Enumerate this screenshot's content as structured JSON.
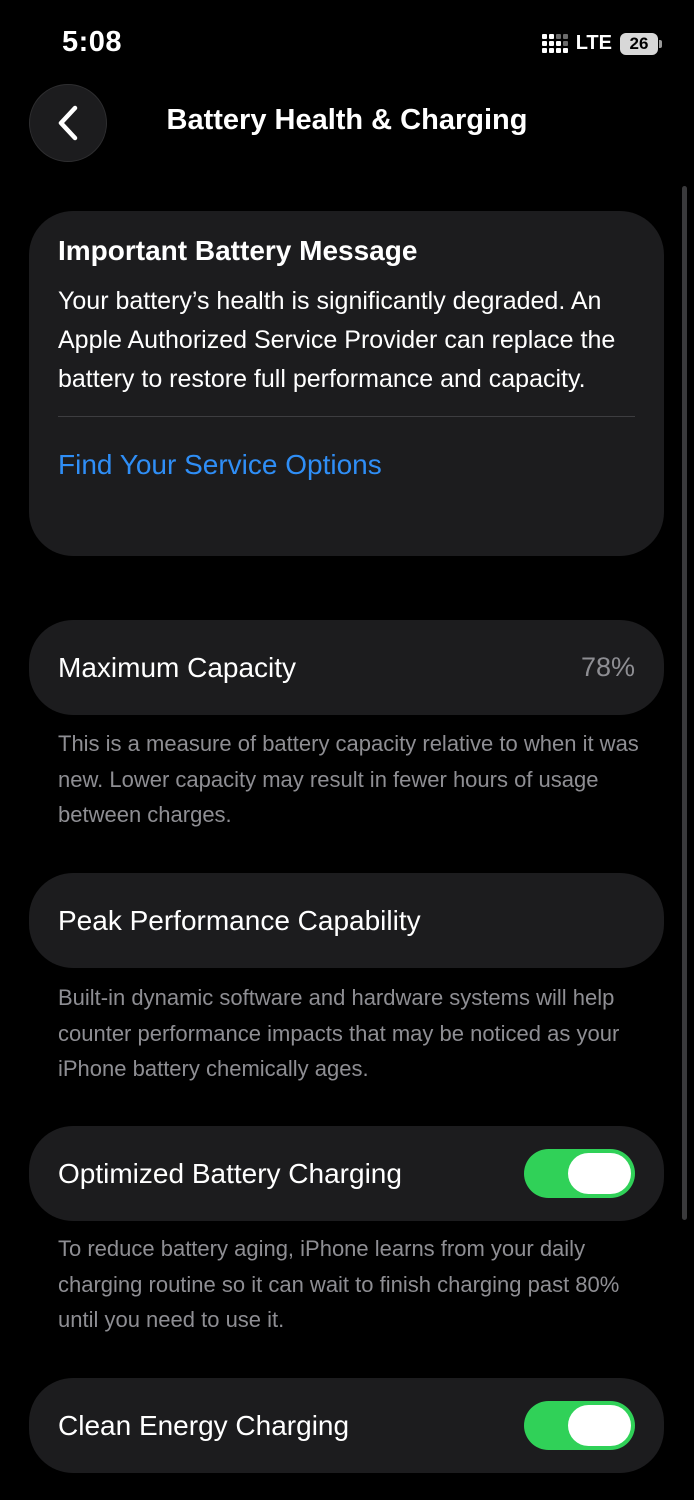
{
  "status_bar": {
    "time": "5:08",
    "network": "LTE",
    "battery_level": "26"
  },
  "nav": {
    "title": "Battery Health & Charging"
  },
  "message": {
    "title": "Important Battery Message",
    "body": "Your battery’s health is significantly degraded. An Apple Authorized Service Provider can replace the battery to restore full performance and capacity.",
    "link": "Find Your Service Options"
  },
  "maximum_capacity": {
    "label": "Maximum Capacity",
    "value": "78%",
    "footnote": "This is a measure of battery capacity relative to when it was new. Lower capacity may result in fewer hours of usage between charges."
  },
  "peak_performance": {
    "label": "Peak Performance Capability",
    "footnote": "Built-in dynamic software and hardware systems will help counter performance impacts that may be noticed as your iPhone battery chemically ages."
  },
  "optimized_charging": {
    "label": "Optimized Battery Charging",
    "enabled": true,
    "footnote": "To reduce battery aging, iPhone learns from your daily charging routine so it can wait to finish charging past 80% until you need to use it."
  },
  "clean_energy": {
    "label": "Clean Energy Charging",
    "enabled": true
  },
  "colors": {
    "background": "#000000",
    "card": "#1c1c1e",
    "link": "#2f8ef6",
    "toggle_on": "#30d158",
    "secondary_text": "#8e8e93"
  }
}
